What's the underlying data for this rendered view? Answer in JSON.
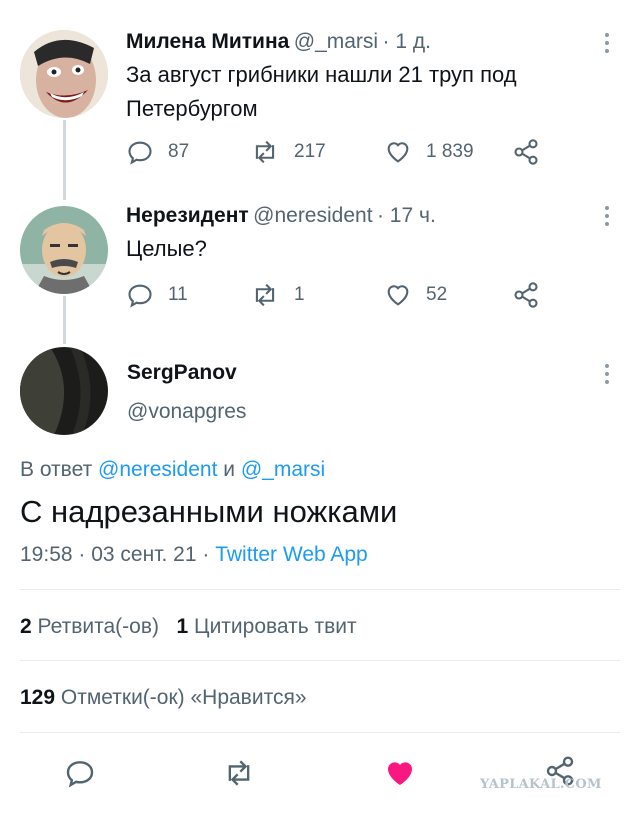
{
  "tweets": [
    {
      "name": "Милена Митина",
      "handle": "@_marsi",
      "time": "· 1 д.",
      "text_line1": "За август грибники нашли 21 труп под",
      "text_line2": "Петербургом",
      "replies": "87",
      "retweets": "217",
      "likes": "1 839"
    },
    {
      "name": "Нерезидент",
      "handle": "@neresident",
      "time": "· 17 ч.",
      "text_line1": "Целые?",
      "replies": "11",
      "retweets": "1",
      "likes": "52"
    }
  ],
  "main": {
    "name": "SergPanov",
    "handle": "@vonapgres",
    "reply_to_prefix": "В ответ",
    "reply_to_user1": "@neresident",
    "reply_to_and": "и",
    "reply_to_user2": "@_marsi",
    "text": "С надрезанными ножками",
    "time": "19:58",
    "date": "· 03 сент. 21 ·",
    "source": "Twitter Web App",
    "retweets_count": "2",
    "retweets_label": "Ретвита(-ов)",
    "quotes_count": "1",
    "quotes_label": "Цитировать твит",
    "likes_count": "129",
    "likes_label": "Отметки(-ок) «Нравится»"
  },
  "watermark": "YAPLAKAL.COM",
  "colors": {
    "accent": "#1d9bf0",
    "like": "#f91880",
    "muted": "#536471"
  }
}
